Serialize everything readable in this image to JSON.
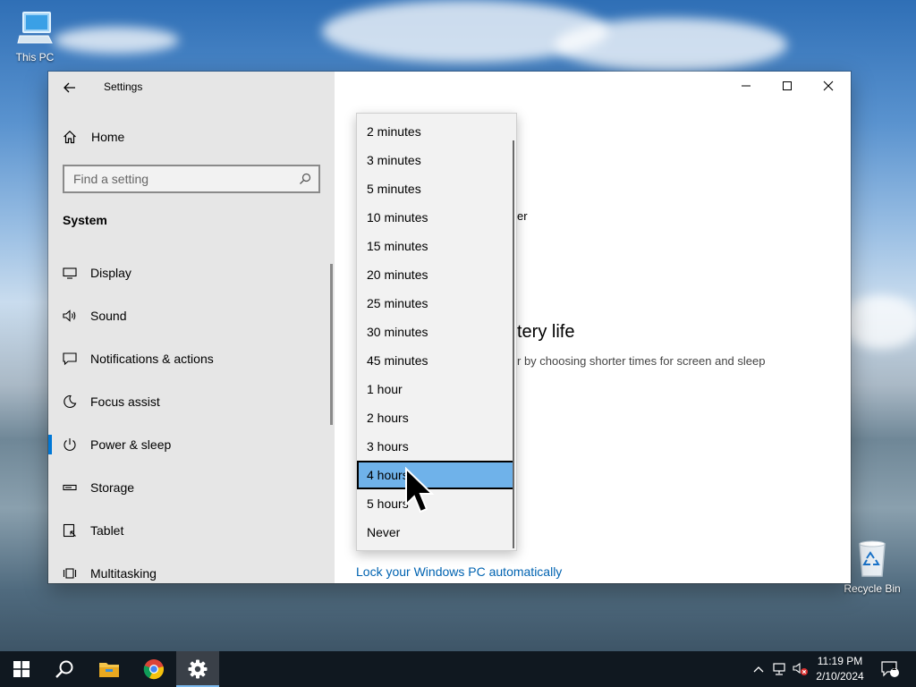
{
  "desktop": {
    "this_pc_label": "This PC",
    "recycle_bin_label": "Recycle Bin"
  },
  "window": {
    "title": "Settings",
    "sidebar": {
      "home_label": "Home",
      "search_placeholder": "Find a setting",
      "section_title": "System",
      "items": [
        {
          "label": "Display",
          "icon": "display-icon"
        },
        {
          "label": "Sound",
          "icon": "speaker-icon"
        },
        {
          "label": "Notifications & actions",
          "icon": "notification-icon"
        },
        {
          "label": "Focus assist",
          "icon": "moon-icon"
        },
        {
          "label": "Power & sleep",
          "icon": "power-icon",
          "selected": true
        },
        {
          "label": "Storage",
          "icon": "storage-icon"
        },
        {
          "label": "Tablet",
          "icon": "tablet-icon"
        },
        {
          "label": "Multitasking",
          "icon": "multitasking-icon"
        }
      ]
    },
    "content": {
      "partial_text_1": "er",
      "partial_heading": "tery life",
      "partial_description": "r by choosing shorter times for screen and sleep",
      "lock_link": "Lock your Windows PC automatically"
    },
    "dropdown": {
      "options": [
        "2 minutes",
        "3 minutes",
        "5 minutes",
        "10 minutes",
        "15 minutes",
        "20 minutes",
        "25 minutes",
        "30 minutes",
        "45 minutes",
        "1 hour",
        "2 hours",
        "3 hours",
        "4 hours",
        "5 hours",
        "Never"
      ],
      "selected": "4 hours"
    }
  },
  "taskbar": {
    "time": "11:19 PM",
    "date": "2/10/2024",
    "notification_count": "1"
  },
  "colors": {
    "accent": "#0078d7",
    "selection": "#6fb2ea",
    "link": "#0063b1",
    "taskbar": "#101820"
  }
}
